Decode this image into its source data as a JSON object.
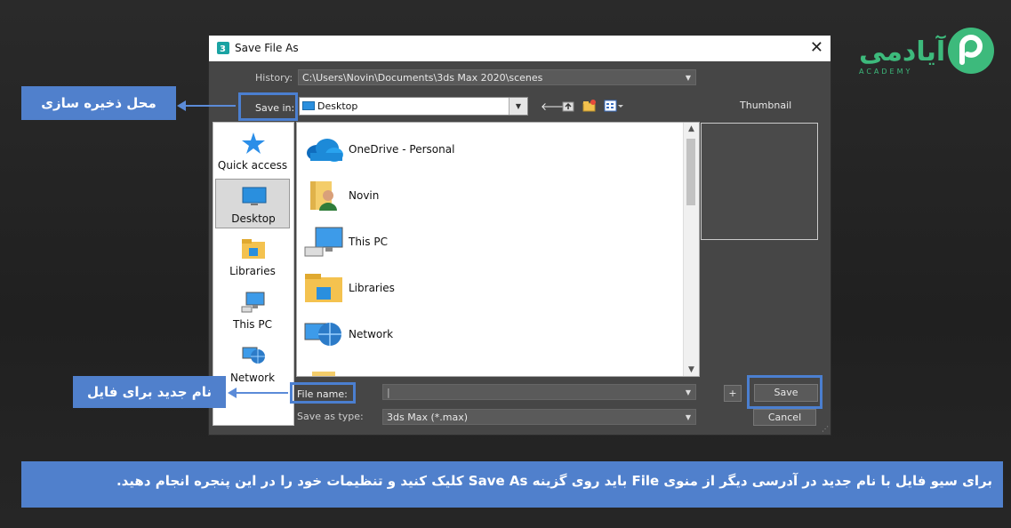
{
  "dialog": {
    "title": "Save File As",
    "history_label": "History:",
    "history_value": "C:\\Users\\Novin\\Documents\\3ds Max 2020\\scenes",
    "save_in_label": "Save in:",
    "save_in_value": "Desktop",
    "thumbnail_label": "Thumbnail",
    "places": [
      {
        "label": "Quick access",
        "icon": "star-icon"
      },
      {
        "label": "Desktop",
        "icon": "desktop-icon",
        "selected": true
      },
      {
        "label": "Libraries",
        "icon": "libraries-folder-icon"
      },
      {
        "label": "This PC",
        "icon": "computer-icon"
      },
      {
        "label": "Network",
        "icon": "network-icon"
      }
    ],
    "files": [
      {
        "name": "OneDrive - Personal",
        "icon": "onedrive-cloud-icon"
      },
      {
        "name": "Novin",
        "icon": "user-folder-icon"
      },
      {
        "name": "This PC",
        "icon": "computer-icon"
      },
      {
        "name": "Libraries",
        "icon": "libraries-folder-icon"
      },
      {
        "name": "Network",
        "icon": "network-icon"
      }
    ],
    "file_name_label": "File name:",
    "file_name_value": "",
    "save_as_type_label": "Save as type:",
    "save_as_type_value": "3ds Max (*.max)",
    "plus_label": "+",
    "save_label": "Save",
    "cancel_label": "Cancel"
  },
  "annotations": {
    "save_location": "محل ذخیره سازی",
    "new_file_name": "نام جدید برای فایل",
    "banner": "برای سیو فایل با نام جدید در آدرسی دیگر از منوی File باید روی گزینه Save As کلیک کنید و تنظیمات خود را در این پنجره انجام دهید."
  },
  "logo": {
    "text": "آیادمی",
    "sub": "ACADEMY"
  },
  "colors": {
    "accent": "#5080cc",
    "logo_green": "#3dba7c"
  }
}
